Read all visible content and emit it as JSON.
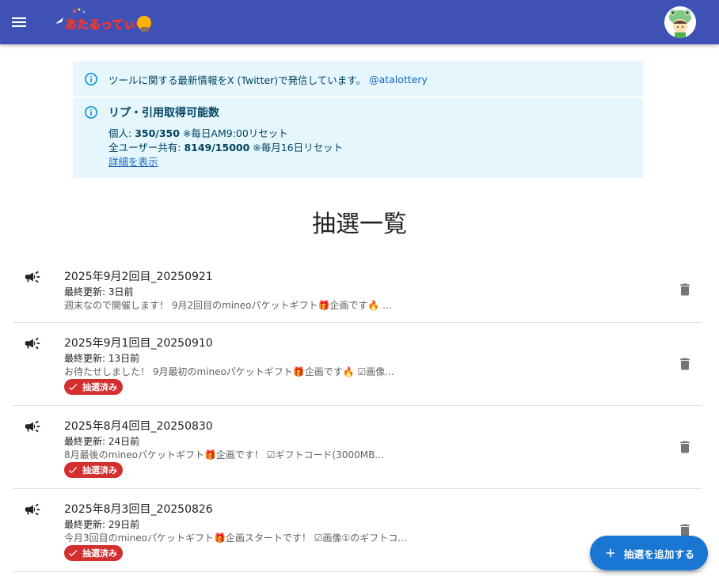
{
  "app": {
    "logo_text": "あたるってぃー",
    "menu_icon": "hamburger-menu-icon",
    "avatar_icon": "frog-hat-avatar-icon",
    "colors": {
      "appbar": "#3f51b5",
      "info_bg": "#e5f6fd",
      "chip": "#d32f2f",
      "fab": "#1976d2"
    }
  },
  "info": {
    "notice_text": "ツールに関する最新情報をX (Twitter)で発信しています。",
    "notice_link": "@atalottery",
    "quota_title": "リプ・引用取得可能数",
    "personal_label": "個人: ",
    "personal_value": "350/350",
    "personal_note": " ※毎日AM9:00リセット",
    "shared_label": "全ユーザー共有: ",
    "shared_value": "8149/15000",
    "shared_note": " ※毎月16日リセット",
    "detail_link": "詳細を表示"
  },
  "page_title": "抽選一覧",
  "lotteries": [
    {
      "title": "2025年9月2回目_20250921",
      "updated": "最終更新: 3日前",
      "desc": "週末なので開催します！ 9月2回目のmineoパケットギフト🎁企画です🔥 ...",
      "badge": ""
    },
    {
      "title": "2025年9月1回目_20250910",
      "updated": "最終更新: 13日前",
      "desc": "お待たせしました！ 9月最初のmineoパケットギフト🎁企画です🔥 ☑画像...",
      "badge": "抽選済み"
    },
    {
      "title": "2025年8月4回目_20250830",
      "updated": "最終更新: 24日前",
      "desc": "8月最後のmineoパケットギフト🎁企画です！ ☑ギフトコード(3000MB...",
      "badge": "抽選済み"
    },
    {
      "title": "2025年8月3回目_20250826",
      "updated": "最終更新: 29日前",
      "desc": "今月3回目のmineoパケットギフト🎁企画スタートです！ ☑画像①のギフトコ...",
      "badge": "抽選済み"
    }
  ],
  "fab_label": "抽選を追加する"
}
